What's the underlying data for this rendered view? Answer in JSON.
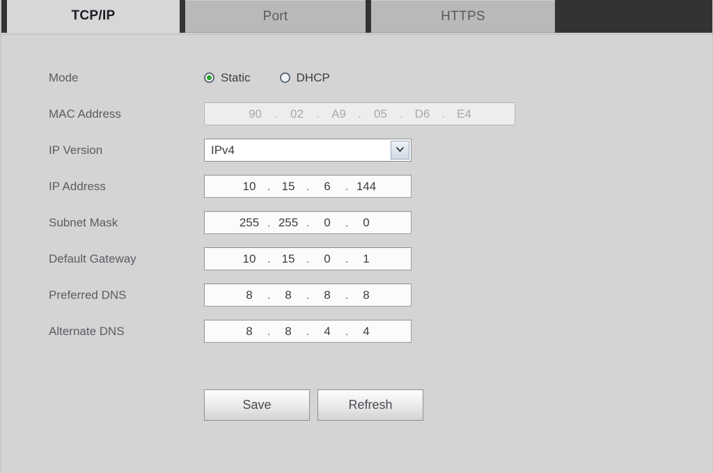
{
  "tabs": [
    {
      "label": "TCP/IP",
      "active": true
    },
    {
      "label": "Port",
      "active": false
    },
    {
      "label": "HTTPS",
      "active": false
    }
  ],
  "form": {
    "mode": {
      "label": "Mode",
      "options": [
        {
          "label": "Static",
          "selected": true
        },
        {
          "label": "DHCP",
          "selected": false
        }
      ]
    },
    "mac_address": {
      "label": "MAC Address",
      "octets": [
        "90",
        "02",
        "A9",
        "05",
        "D6",
        "E4"
      ],
      "separator": "."
    },
    "ip_version": {
      "label": "IP Version",
      "value": "IPv4"
    },
    "ip_address": {
      "label": "IP Address",
      "octets": [
        "10",
        "15",
        "6",
        "144"
      ],
      "separator": "."
    },
    "subnet_mask": {
      "label": "Subnet Mask",
      "octets": [
        "255",
        "255",
        "0",
        "0"
      ],
      "separator": "."
    },
    "default_gateway": {
      "label": "Default Gateway",
      "octets": [
        "10",
        "15",
        "0",
        "1"
      ],
      "separator": "."
    },
    "preferred_dns": {
      "label": "Preferred DNS",
      "octets": [
        "8",
        "8",
        "8",
        "8"
      ],
      "separator": "."
    },
    "alternate_dns": {
      "label": "Alternate DNS",
      "octets": [
        "8",
        "8",
        "4",
        "4"
      ],
      "separator": "."
    }
  },
  "actions": {
    "save_label": "Save",
    "refresh_label": "Refresh"
  },
  "colors": {
    "page_background": "#d4d4d4",
    "tabbar_background": "#333333",
    "active_tab_background": "#d7d7d7",
    "inactive_tab_background": "#b9b9b9",
    "radio_selected_dot": "#28a428",
    "label_text": "#5b5b63",
    "value_text": "#3a3a42"
  }
}
